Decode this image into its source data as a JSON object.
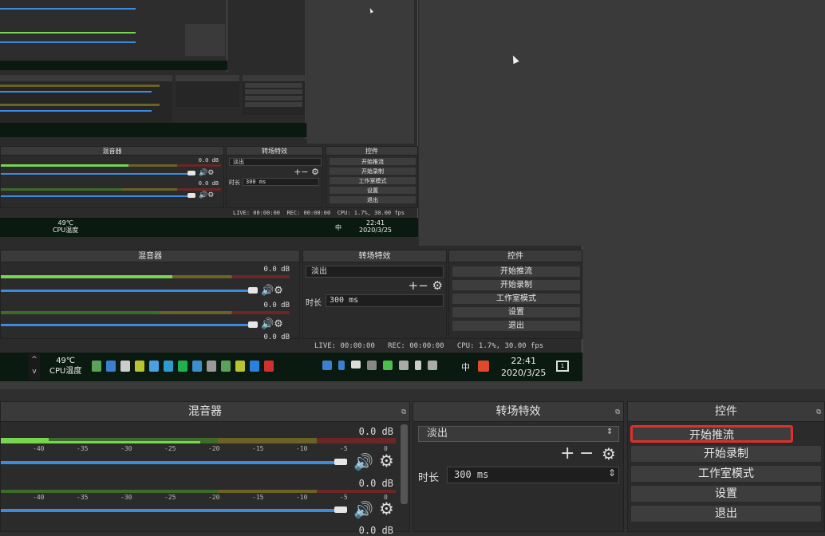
{
  "mixer": {
    "title": "混音器",
    "db1": "0.0 dB",
    "db2": "0.0 dB",
    "db3": "0.0 dB"
  },
  "transitions": {
    "title": "转场特效",
    "selected": "淡出",
    "duration_label": "时长",
    "duration_value": "300 ms",
    "add": "+",
    "remove": "−"
  },
  "controls": {
    "title": "控件",
    "start_stream": "开始推流",
    "start_record": "开始录制",
    "studio_mode": "工作室模式",
    "settings": "设置",
    "exit": "退出"
  },
  "ticks": [
    "-40",
    "-35",
    "-30",
    "-25",
    "-20",
    "-15",
    "-10",
    "-5",
    "0"
  ],
  "status": {
    "live": "LIVE: 00:00:00",
    "rec": "REC: 00:00:00",
    "cpu": "CPU: 1.7%, 30.00 fps"
  },
  "taskbar": {
    "temp": "49℃",
    "cpu_label": "CPU温度",
    "time": "22:41",
    "date": "2020/3/25",
    "ime": "中",
    "notify": "1"
  },
  "colors": {
    "accent_red": "#e0302a",
    "meter_green": "#76d64f",
    "slider_blue": "#3d8be0"
  }
}
